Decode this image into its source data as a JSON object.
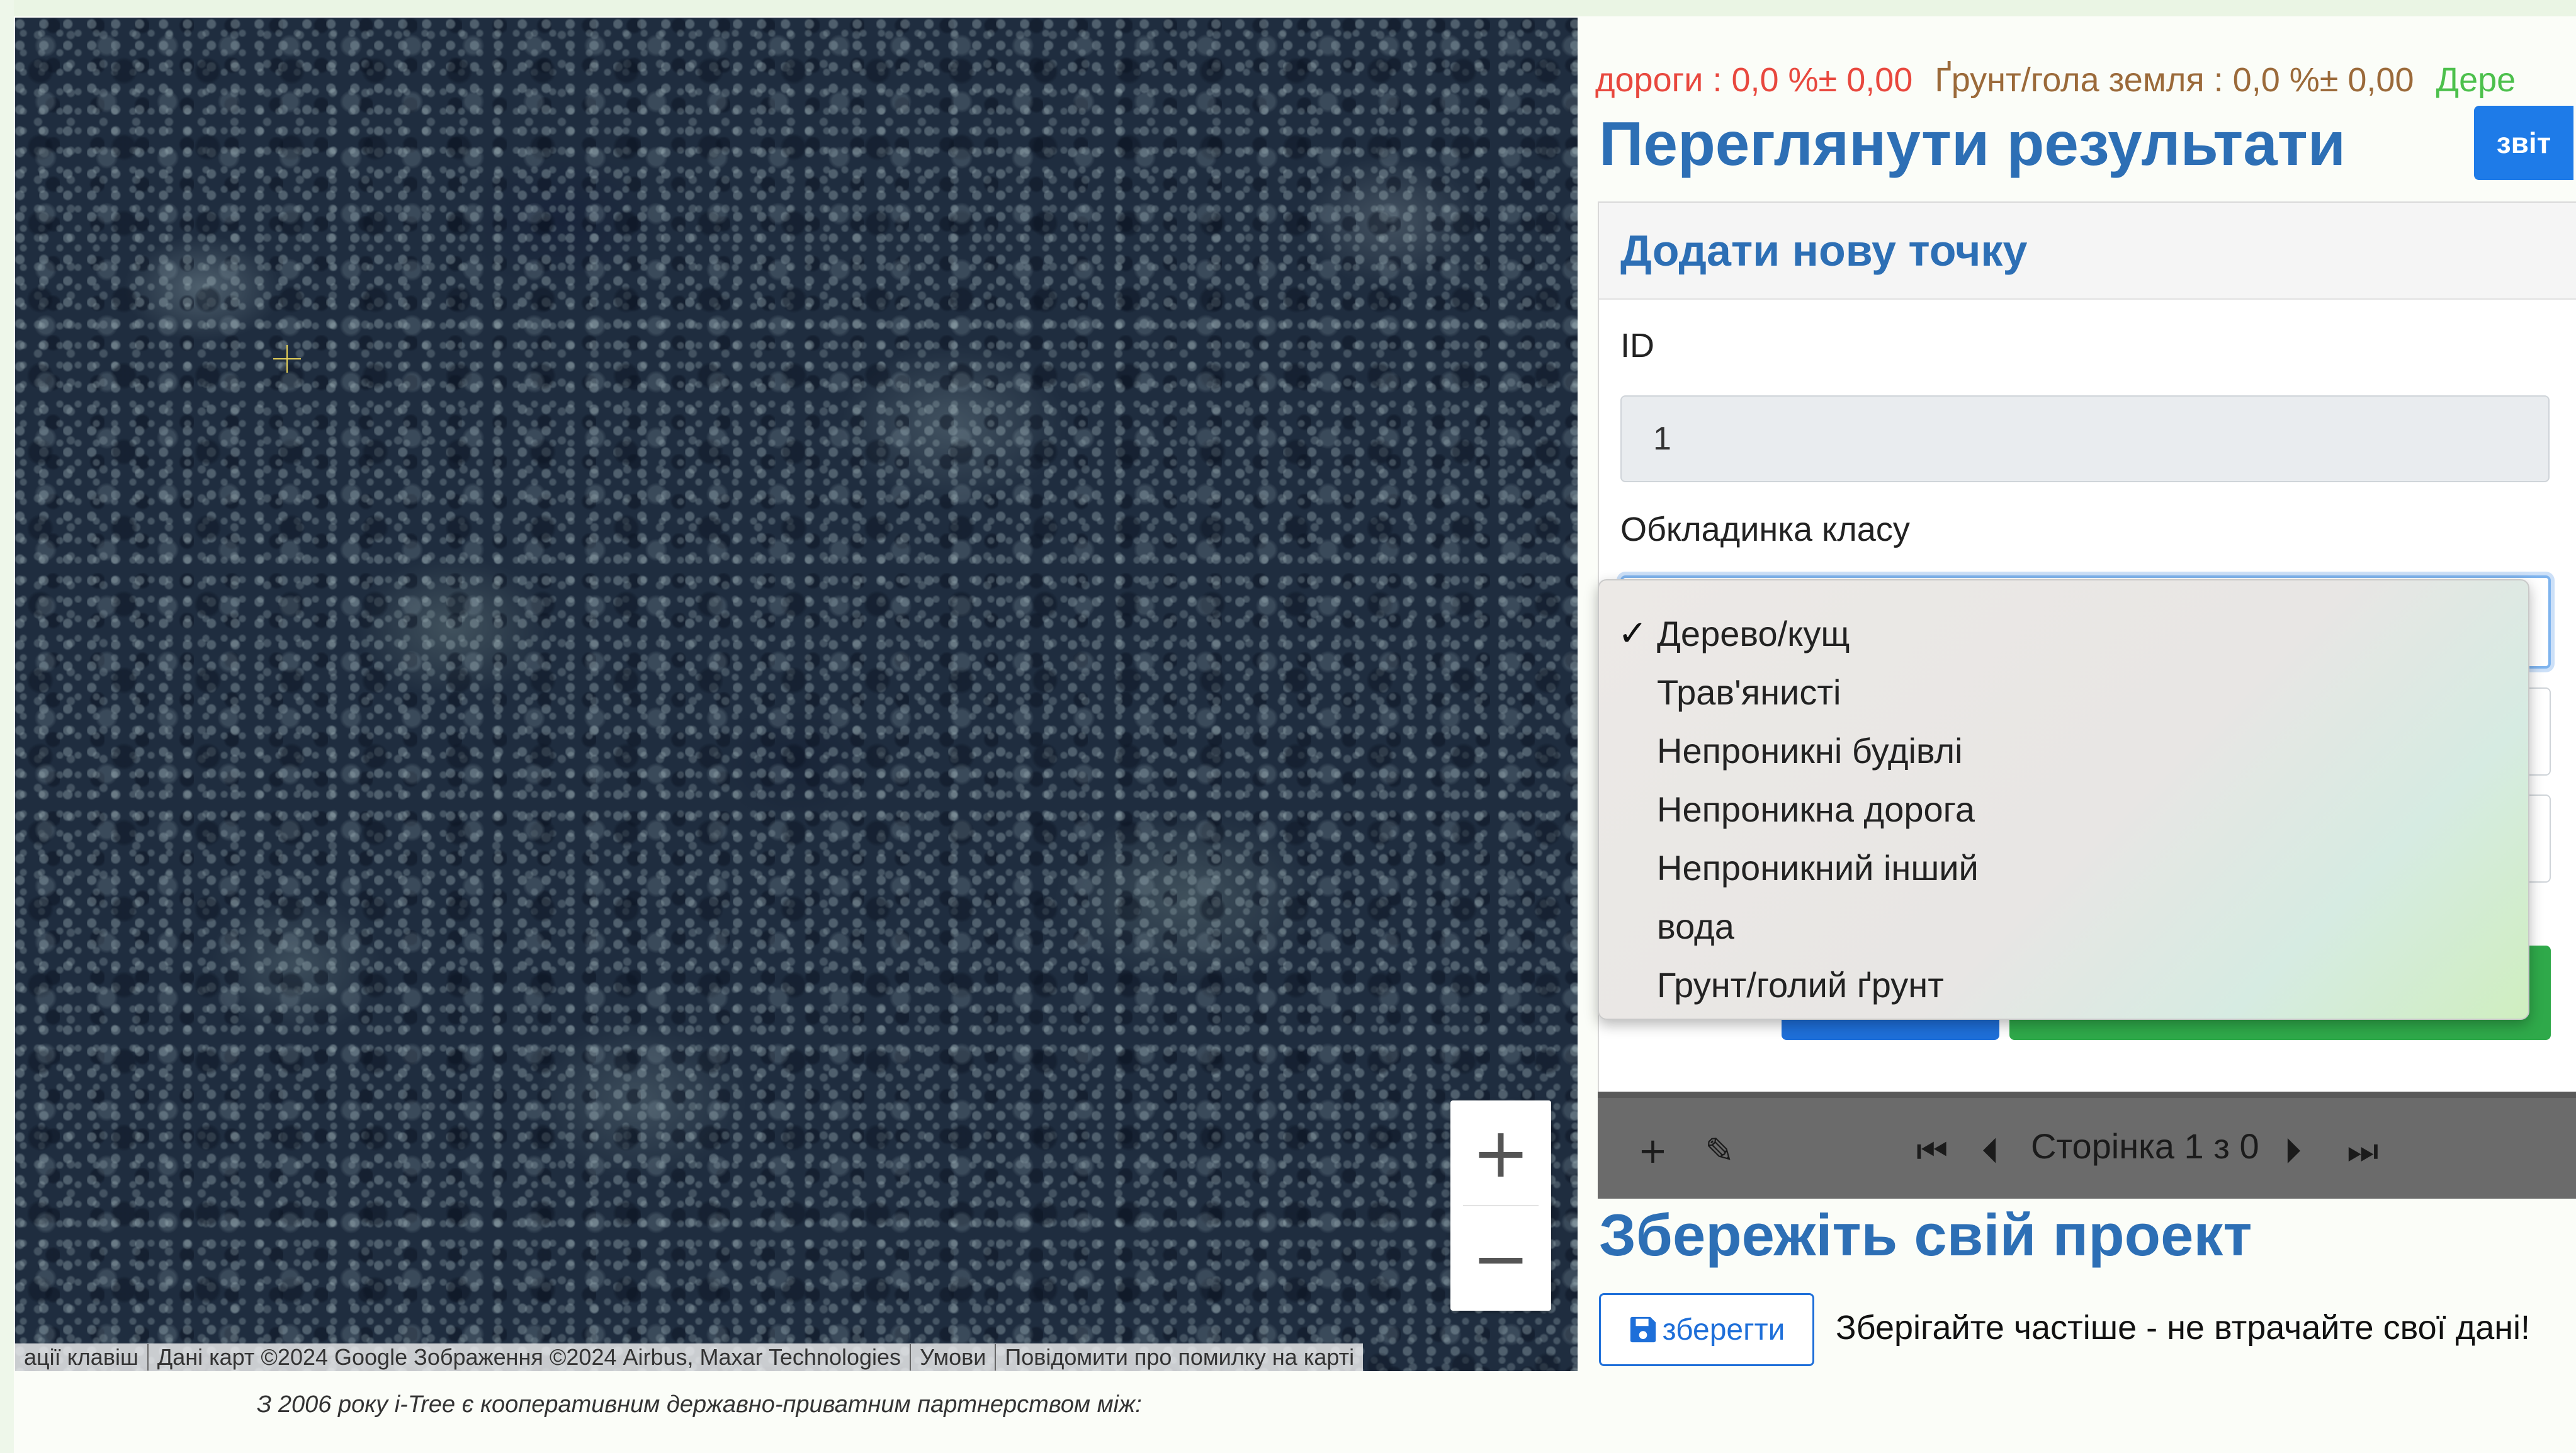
{
  "summary": {
    "roads": "дороги : 0,0 %± 0,00",
    "soil": "Ґрунт/гола земля : 0,0 %± 0,00",
    "trees": "Дере"
  },
  "results": {
    "title": "Переглянути результати",
    "report_label": "звіт"
  },
  "add_point": {
    "header": "Додати нову точку",
    "id_label": "ID",
    "id_value": "1",
    "class_label": "Обкладинка класу",
    "selected_check": "✓",
    "options": [
      "Дерево/кущ",
      "Трав'янисті",
      "Непроникні будівлі",
      "Непроникна дорога",
      "Непроникний інший",
      "вода",
      "Грунт/голий ґрунт"
    ]
  },
  "pager": {
    "add_icon": "+",
    "edit_icon": "✎",
    "first": "⏮",
    "prev": "⏴",
    "page_text": "Сторінка 1 з 0",
    "next": "⏵",
    "last": "⏭"
  },
  "map": {
    "zoom_in": "+",
    "zoom_out": "−",
    "attribution": [
      "ації клавіш",
      "Дані карт ©2024 Google Зображення ©2024 Airbus, Maxar Technologies",
      "Умови",
      "Повідомити про помилку на карті"
    ]
  },
  "footer_note": "З 2006 року i-Tree є кооперативним державно-приватним партнерством між:",
  "save": {
    "title": "Збережіть свій проект",
    "button_label": "зберегти",
    "hint": "Зберігайте частіше - не втрачайте свої дані!"
  },
  "colors": {
    "accent_blue": "#2d6fb5",
    "button_blue": "#1e7be8",
    "button_green": "#2fa94a",
    "roads_red": "#e8483e",
    "soil_brown": "#9b6a3a",
    "trees_green": "#4cc04c"
  }
}
